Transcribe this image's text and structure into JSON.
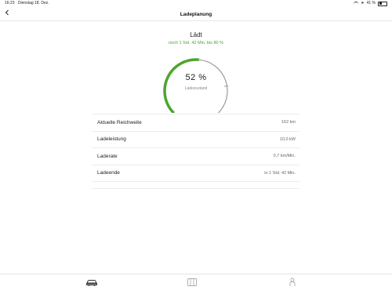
{
  "status_bar": {
    "time": "16:23",
    "date": "Dienstag 18. Dez.",
    "battery_text": "41 %",
    "battery_level": 0.41
  },
  "nav": {
    "back_icon": "chevron-left-icon",
    "title": "Ladeplanung"
  },
  "charging": {
    "status": "Lädt",
    "remaining": "noch 1 Std. 42 Min. bis 80 %",
    "accent_color": "#4ca52e"
  },
  "gauge": {
    "value_text": "52 %",
    "label": "Ladezustand",
    "level": 0.52,
    "target_level": 0.8,
    "fill_color": "#4ca52e",
    "track_color": "#9a9a9a"
  },
  "info_rows": [
    {
      "label": "Aktuelle Reichweite",
      "value": "162 km"
    },
    {
      "label": "Ladeleistung",
      "value": "10,0 kW"
    },
    {
      "label": "Laderate",
      "value": "0,7 km/Min."
    },
    {
      "label": "Ladeende",
      "value": "in 1 Std. 42 Min."
    }
  ],
  "tab_bar": {
    "tabs": [
      {
        "icon": "car-icon",
        "active": true
      },
      {
        "icon": "map-icon",
        "active": false
      },
      {
        "icon": "person-icon",
        "active": false
      }
    ]
  }
}
